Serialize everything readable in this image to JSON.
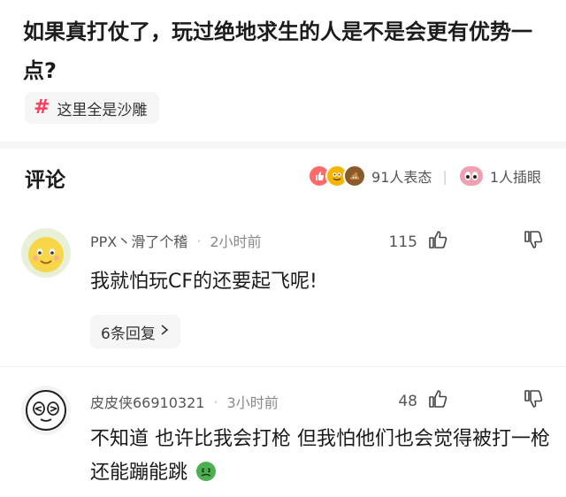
{
  "post": {
    "title": "如果真打仗了，玩过绝地求生的人是不是会更有优势一点?",
    "tag": {
      "icon": "hash-icon",
      "label": "这里全是沙雕"
    }
  },
  "comments_section": {
    "title": "评论",
    "reactions": {
      "biaotai_count": "91人表态",
      "chayan_count": "1人插眼",
      "separator": "|"
    }
  },
  "comments": [
    {
      "author": "PPX丶滑了个稽",
      "time": "2小时前",
      "likes": "115",
      "text": "我就怕玩CF的还要起飞呢!",
      "replies": "6条回复",
      "avatar": "yellow-cartoon-avatar"
    },
    {
      "author": "皮皮侠66910321",
      "time": "3小时前",
      "likes": "48",
      "text": "不知道 也许比我会打枪 但我怕他们也会觉得被打一枪还能蹦能跳",
      "avatar": "white-emoji-avatar"
    }
  ],
  "colors": {
    "accent": "#ff3b5c",
    "tag_bg": "#f5f5f5",
    "muted": "#888888"
  }
}
